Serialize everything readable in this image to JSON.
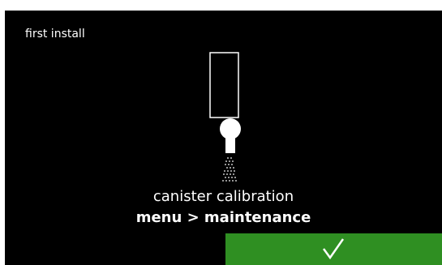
{
  "screen": {
    "title": "first install"
  },
  "instruction": {
    "line1": "canister calibration",
    "line2": "menu > maintenance"
  },
  "confirm_button": {
    "icon": "checkmark-icon",
    "color": "#2f8f22"
  },
  "illustration": {
    "icon": "canister-dispense-icon"
  }
}
